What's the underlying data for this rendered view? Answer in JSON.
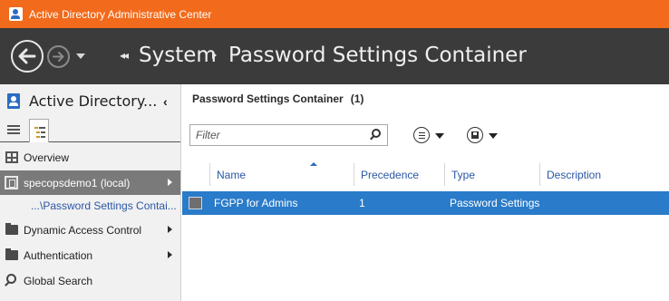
{
  "window": {
    "title": "Active Directory Administrative Center"
  },
  "navbar": {
    "breadcrumb": [
      "System",
      "Password Settings Container"
    ]
  },
  "sidebar": {
    "title": "Active Directory...",
    "items": [
      {
        "label": "Overview",
        "icon": "overview-icon"
      },
      {
        "label": "specopsdemo1 (local)",
        "icon": "domain-icon",
        "selected": true
      },
      {
        "label": "...\\Password Settings Contai...",
        "sub": true
      },
      {
        "label": "Dynamic Access Control",
        "icon": "folder-icon"
      },
      {
        "label": "Authentication",
        "icon": "folder-icon"
      },
      {
        "label": "Global Search",
        "icon": "search-icon"
      }
    ]
  },
  "main": {
    "title": "Password Settings Container",
    "count": "(1)",
    "filter_placeholder": "Filter",
    "columns": [
      "Name",
      "Precedence",
      "Type",
      "Description"
    ],
    "rows": [
      {
        "name": "FGPP for Admins",
        "precedence": "1",
        "type": "Password Settings",
        "description": ""
      }
    ]
  },
  "colors": {
    "titlebar": "#f26a1b",
    "navbar": "#3b3b3b",
    "selection": "#2a7bc9",
    "link": "#2b57a4"
  }
}
